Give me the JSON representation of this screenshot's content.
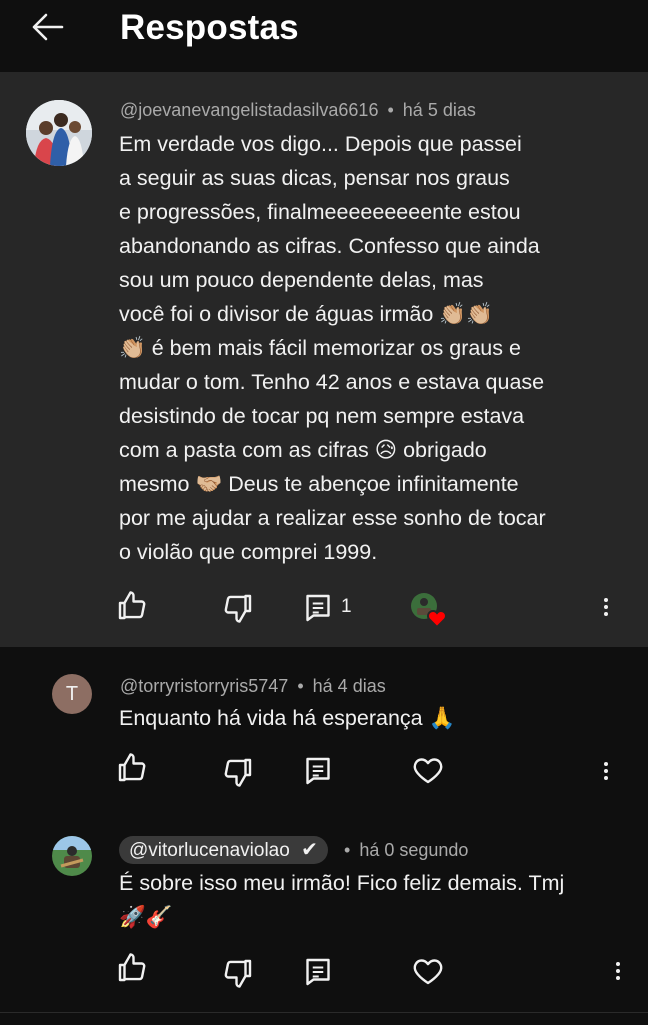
{
  "header": {
    "title": "Respostas"
  },
  "main_comment": {
    "author": "@joevanevangelistadasilva6616",
    "separator": "•",
    "time": "há 5 dias",
    "lines": [
      "Em verdade vos digo... Depois que passei",
      "a seguir as suas dicas, pensar nos graus",
      "e progressões, finalmeeeeeeeeente estou",
      "abandonando as cifras. Confesso que ainda",
      "sou um pouco dependente delas, mas",
      "você foi o divisor de águas irmão 👏🏼👏🏼",
      "👏🏼 é bem mais fácil memorizar os graus e",
      "mudar o tom. Tenho 42 anos e estava quase",
      "desistindo de tocar pq nem sempre estava",
      "com a pasta com as cifras 😥 obrigado",
      "mesmo 🤝🏼 Deus te abençoe infinitamente",
      "por me ajudar a realizar esse sonho de tocar",
      "o violão que comprei 1999."
    ],
    "reply_count": "1"
  },
  "replies": [
    {
      "avatar_letter": "T",
      "author": "@torryristorryris5747",
      "separator": "•",
      "time": "há 4 dias",
      "lines": [
        "Enquanto há vida há esperança 🙏"
      ]
    },
    {
      "author": "@vitorlucenaviolao",
      "verified_mark": "✔",
      "separator": "•",
      "time": "há 0 segundo",
      "lines": [
        "É sobre isso meu irmão! Fico feliz demais. Tmj",
        "🚀🎸"
      ]
    }
  ],
  "colors": {
    "background": "#0f0f0f",
    "highlight": "#272727",
    "meta": "#aaaaaa",
    "heart": "#ff0000",
    "avatar_t": "#8d6e63"
  },
  "icons": [
    "back-arrow-icon",
    "thumbs-up-icon",
    "thumbs-down-icon",
    "reply-icon",
    "heart-icon",
    "more-vert-icon",
    "verified-icon"
  ]
}
